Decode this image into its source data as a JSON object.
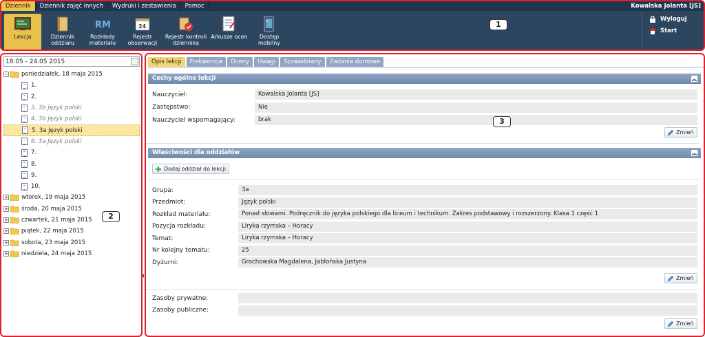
{
  "menu": {
    "items": [
      "Dziennik",
      "Dziennik zajęć innych",
      "Wydruki i zestawienia",
      "Pomoc"
    ],
    "active_index": 0
  },
  "user": {
    "name": "Kowalska Jolanta [JS]"
  },
  "toolbar": {
    "buttons": [
      {
        "label": "Lekcja",
        "icon": "lesson-icon",
        "active": true
      },
      {
        "label": "Dziennik oddziału",
        "icon": "class-journal-icon"
      },
      {
        "label": "Rozkłady materiału",
        "icon": "rm-icon"
      },
      {
        "label": "Rejestr obserwacji",
        "icon": "calendar-24-icon"
      },
      {
        "label": "Rejestr kontroli dziennika",
        "icon": "journal-control-icon"
      },
      {
        "label": "Arkusze ocen",
        "icon": "grade-sheet-icon"
      },
      {
        "label": "Dostęp mobilny",
        "icon": "mobile-icon"
      }
    ],
    "right_links": [
      {
        "label": "Wyloguj",
        "icon": "lock-icon"
      },
      {
        "label": "Start",
        "icon": "home-icon"
      }
    ]
  },
  "tree": {
    "week_range": "18.05 - 24.05 2015",
    "days": [
      {
        "label": "poniedziałek, 18 maja 2015",
        "expanded": true,
        "lessons": [
          {
            "label": "1.",
            "dim": false
          },
          {
            "label": "2.",
            "dim": false
          },
          {
            "label": "3. 3b Język polski",
            "dim": true
          },
          {
            "label": "4. 3b Język polski",
            "dim": true
          },
          {
            "label": "5. 3a Język polski",
            "dim": false,
            "selected": true
          },
          {
            "label": "6. 3a Język polski",
            "dim": true
          },
          {
            "label": "7.",
            "dim": false
          },
          {
            "label": "8.",
            "dim": false
          },
          {
            "label": "9.",
            "dim": false
          },
          {
            "label": "10.",
            "dim": false
          }
        ]
      },
      {
        "label": "wtorek, 19 maja 2015"
      },
      {
        "label": "środa, 20 maja 2015"
      },
      {
        "label": "czwartek, 21 maja 2015"
      },
      {
        "label": "piątek, 22 maja 2015"
      },
      {
        "label": "sobota, 23 maja 2015"
      },
      {
        "label": "niedziela, 24 maja 2015"
      }
    ]
  },
  "tabs": [
    "Opis lekcji",
    "Frekwencja",
    "Oceny",
    "Uwagi",
    "Sprawdziany",
    "Zadania domowe"
  ],
  "general": {
    "title": "Cechy ogólne lekcji",
    "fields": [
      {
        "label": "Nauczyciel:",
        "value": "Kowalska Jolanta [JS]"
      },
      {
        "label": "Zastępstwo:",
        "value": "Nie"
      },
      {
        "label": "Nauczyciel wspomagający:",
        "value": "brak"
      }
    ],
    "change_label": "Zmień"
  },
  "class_props": {
    "title": "Właściwości dla oddziałów",
    "add_label": "Dodaj oddział do lekcji",
    "fields": [
      {
        "label": "Grupa:",
        "value": "3a"
      },
      {
        "label": "Przedmiot:",
        "value": "Język polski"
      },
      {
        "label": "Rozkład materiału:",
        "value": "Ponad słowami. Podręcznik do języka polskiego dla liceum i technikum. Zakres podstawowy i rozszerzony. Klasa 1 część 1"
      },
      {
        "label": "Pozycja rozkładu:",
        "value": "Liryka rzymska – Horacy"
      },
      {
        "label": "Temat:",
        "value": "Liryka rzymska – Horacy"
      },
      {
        "label": "Nr kolejny tematu:",
        "value": "25"
      },
      {
        "label": "Dyżurni:",
        "value": "Grochowska Magdalena, Jabłońska Justyna"
      }
    ],
    "change_label": "Zmień"
  },
  "resources": {
    "fields": [
      {
        "label": "Zasoby prywatne:",
        "value": ""
      },
      {
        "label": "Zasoby publiczne:",
        "value": ""
      }
    ],
    "change_label": "Zmień"
  },
  "callouts": [
    "1",
    "2",
    "3"
  ],
  "colors": {
    "toolbar_bg": "#2c4660",
    "accent_active": "#f0c64a",
    "section_header": "#7f97b9",
    "annotation_border": "#e0202c"
  }
}
